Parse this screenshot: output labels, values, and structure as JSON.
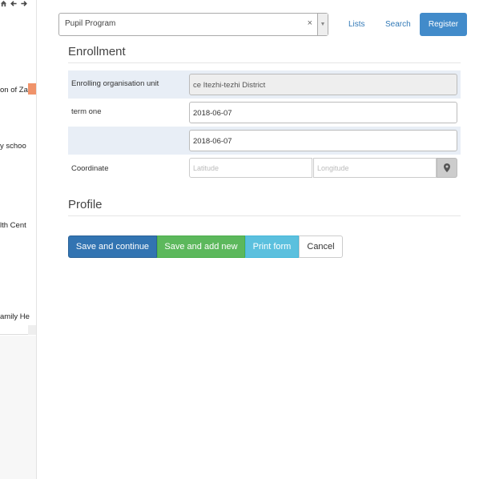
{
  "tree": {
    "items": [
      {
        "label": "on of Za"
      },
      {
        "label": "y schoo"
      },
      {
        "label": "lth Cent"
      },
      {
        "label": "amily He"
      }
    ]
  },
  "header": {
    "program_value": "Pupil Program",
    "clear_symbol": "×",
    "arrow_symbol": "▼",
    "lists_label": "Lists",
    "search_label": "Search",
    "register_label": "Register"
  },
  "enrollment": {
    "title": "Enrollment",
    "org_unit_label": "Enrolling organisation unit",
    "org_unit_value": "ce Itezhi-tezhi District",
    "term_one_label": "term one",
    "term_one_value": "2018-06-07",
    "second_date_value": "2018-06-07",
    "coordinate_label": "Coordinate",
    "latitude_placeholder": "Latitude",
    "longitude_placeholder": "Longitude"
  },
  "profile": {
    "title": "Profile"
  },
  "actions": {
    "save_continue": "Save and continue",
    "save_add_new": "Save and add new",
    "print_form": "Print form",
    "cancel": "Cancel"
  }
}
